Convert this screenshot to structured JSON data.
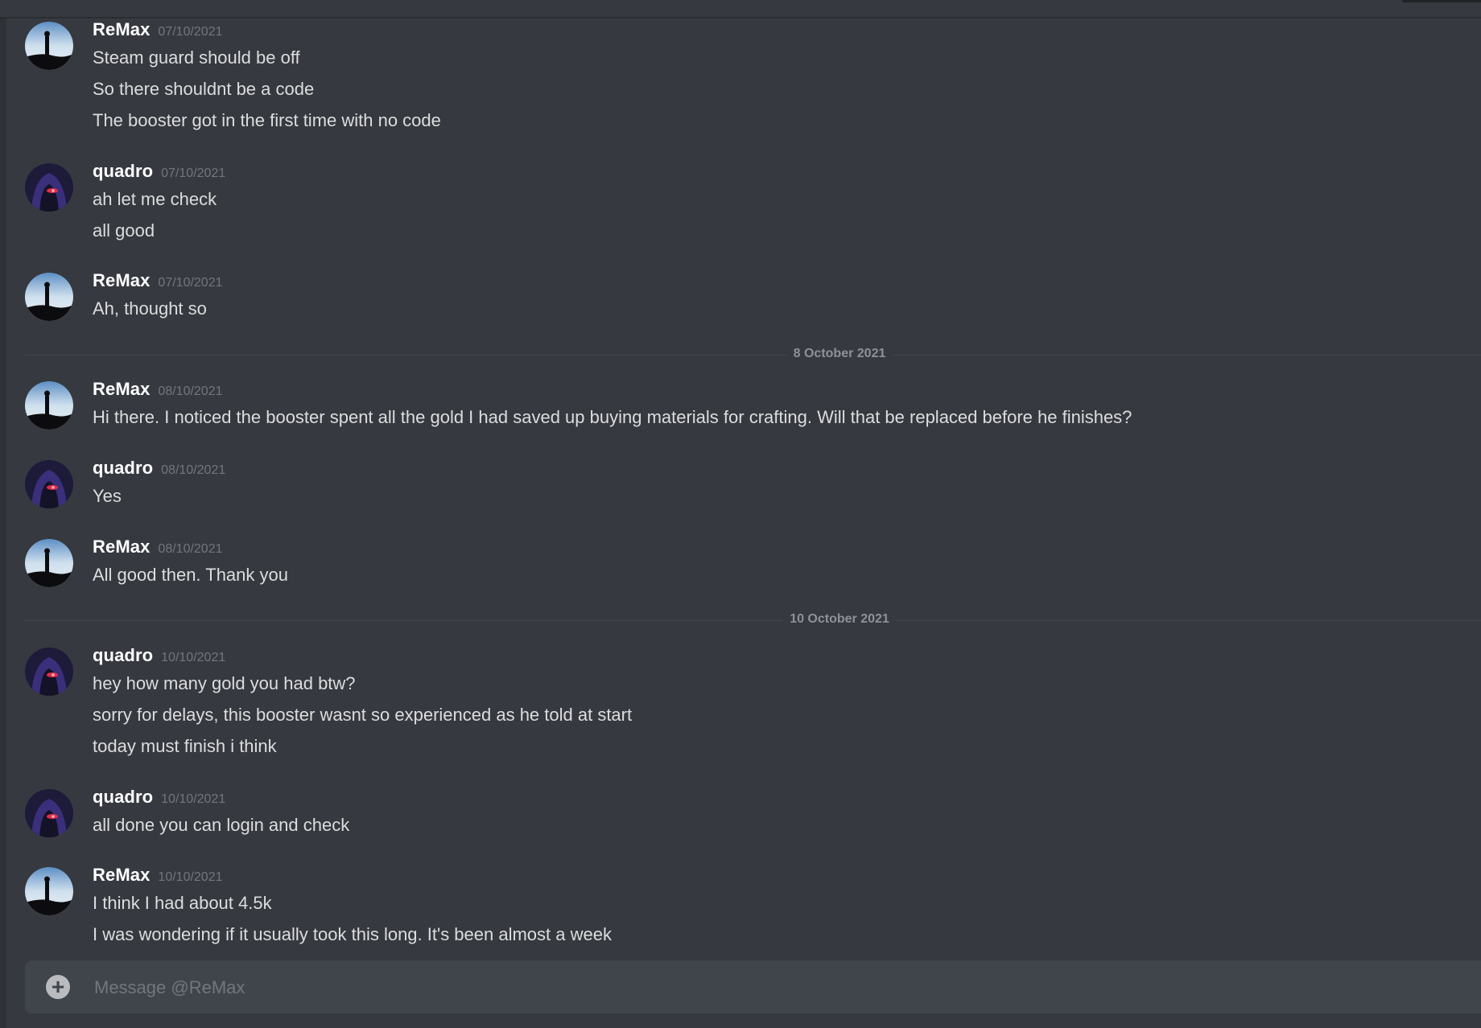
{
  "theme": {
    "background": "#36393f",
    "text": "#dcddde",
    "username": "#ffffff",
    "muted": "#72767d",
    "composer": "#40444b"
  },
  "messages": [
    {
      "author": "ReMax",
      "timestamp": "07/10/2021",
      "avatar": "silhouette-avatar",
      "lines": [
        "Steam guard should be off",
        "So there shouldnt be a code",
        "The booster got in the first time with no code"
      ]
    },
    {
      "author": "quadro",
      "timestamp": "07/10/2021",
      "avatar": "hooded-figure-avatar",
      "lines": [
        "ah let me check",
        "all good"
      ]
    },
    {
      "author": "ReMax",
      "timestamp": "07/10/2021",
      "avatar": "silhouette-avatar",
      "lines": [
        "Ah, thought so"
      ]
    },
    {
      "author": "ReMax",
      "timestamp": "08/10/2021",
      "avatar": "silhouette-avatar",
      "lines": [
        "Hi there. I noticed the booster spent all the gold I had saved up buying materials for crafting. Will that be replaced before he finishes?"
      ]
    },
    {
      "author": "quadro",
      "timestamp": "08/10/2021",
      "avatar": "hooded-figure-avatar",
      "lines": [
        "Yes"
      ]
    },
    {
      "author": "ReMax",
      "timestamp": "08/10/2021",
      "avatar": "silhouette-avatar",
      "lines": [
        "All good then. Thank you"
      ]
    },
    {
      "author": "quadro",
      "timestamp": "10/10/2021",
      "avatar": "hooded-figure-avatar",
      "lines": [
        "hey how many gold you had btw?",
        "sorry for delays, this booster wasnt so experienced as he told at start",
        "today must finish i think"
      ]
    },
    {
      "author": "quadro",
      "timestamp": "10/10/2021",
      "avatar": "hooded-figure-avatar",
      "lines": [
        "all done you can login and check"
      ]
    },
    {
      "author": "ReMax",
      "timestamp": "10/10/2021",
      "avatar": "silhouette-avatar",
      "lines": [
        "I think I had about 4.5k",
        "I was wondering if it usually took this long. It's been almost a week"
      ]
    }
  ],
  "dividers": [
    "8 October 2021",
    "10 October 2021"
  ],
  "composer": {
    "placeholder": "Message @ReMax",
    "value": "",
    "attach_icon": "plus-circle-icon"
  }
}
